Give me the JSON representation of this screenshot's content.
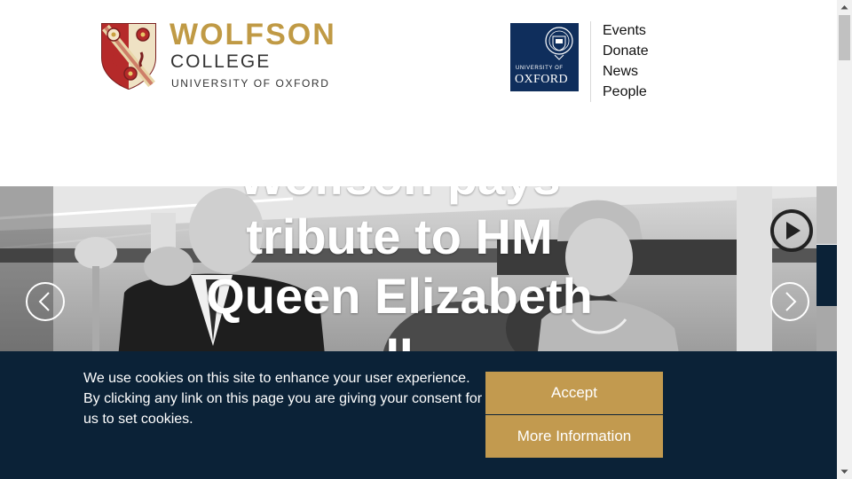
{
  "header": {
    "college_logo": {
      "name": "WOLFSON",
      "subtitle": "COLLEGE",
      "university": "UNIVERSITY OF OXFORD"
    },
    "oxford_logo": {
      "small_text": "UNIVERSITY OF",
      "name": "OXFORD"
    },
    "nav": [
      {
        "label": "Events"
      },
      {
        "label": "Donate"
      },
      {
        "label": "News"
      },
      {
        "label": "People"
      }
    ]
  },
  "hero": {
    "title": "Wolfson pays tribute to HM Queen Elizabeth II"
  },
  "cookie_banner": {
    "lines": [
      "We use cookies on this site to enhance your user experience.",
      "By clicking any link on this page you are giving your consent for us to set cookies."
    ],
    "accept_label": "Accept",
    "more_info_label": "More Information"
  },
  "colors": {
    "gold": "#c09a45",
    "navy": "#0b2237",
    "oxford_blue": "#0f2e5c",
    "button": "#c29a4f"
  },
  "icons": {
    "prev": "chevron-left-icon",
    "next": "chevron-right-icon",
    "play": "play-icon",
    "crest": "college-crest-icon",
    "oxford_crest": "oxford-crest-icon"
  }
}
